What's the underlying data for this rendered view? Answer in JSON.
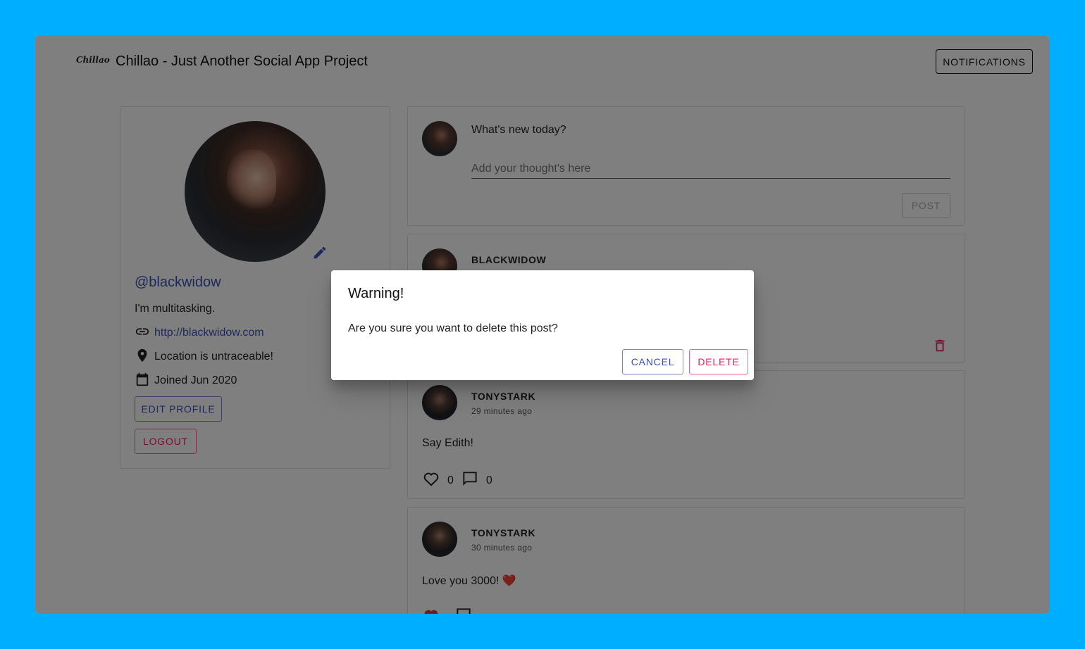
{
  "header": {
    "logo_text": "Chillao",
    "title": "Chillao - Just Another Social App Project",
    "notifications_label": "NOTIFICATIONS"
  },
  "profile": {
    "handle": "@blackwidow",
    "bio": "I'm multitasking.",
    "website": "http://blackwidow.com",
    "location": "Location is untraceable!",
    "joined": "Joined Jun 2020",
    "edit_profile_label": "EDIT PROFILE",
    "logout_label": "LOGOUT",
    "icons": [
      "edit-pencil-icon",
      "link-icon",
      "location-pin-icon",
      "calendar-icon"
    ],
    "accent_color": "#3f51b5",
    "danger_color": "#e91e63"
  },
  "composer": {
    "prompt": "What's new today?",
    "placeholder": "Add your thought's here",
    "post_label": "POST"
  },
  "posts": [
    {
      "author": "BLACKWIDOW",
      "time": "",
      "body": "",
      "likes": "",
      "comments": "",
      "icons": [
        "trash-icon"
      ]
    },
    {
      "author": "TONYSTARK",
      "time": "29 minutes ago",
      "body": "Say Edith!",
      "likes": "0",
      "comments": "0",
      "icons": [
        "heart-outline-icon",
        "comment-icon"
      ]
    },
    {
      "author": "TONYSTARK",
      "time": "30 minutes ago",
      "body": "Love you 3000! ❤️",
      "likes": "",
      "comments": "",
      "icons": [
        "heart-filled-icon",
        "comment-icon"
      ]
    }
  ],
  "dialog": {
    "title": "Warning!",
    "message": "Are you sure you want to delete this post?",
    "cancel_label": "CANCEL",
    "delete_label": "DELETE"
  },
  "colors": {
    "background": "#00aeff",
    "overlay": "rgba(0,0,0,0.5)"
  }
}
